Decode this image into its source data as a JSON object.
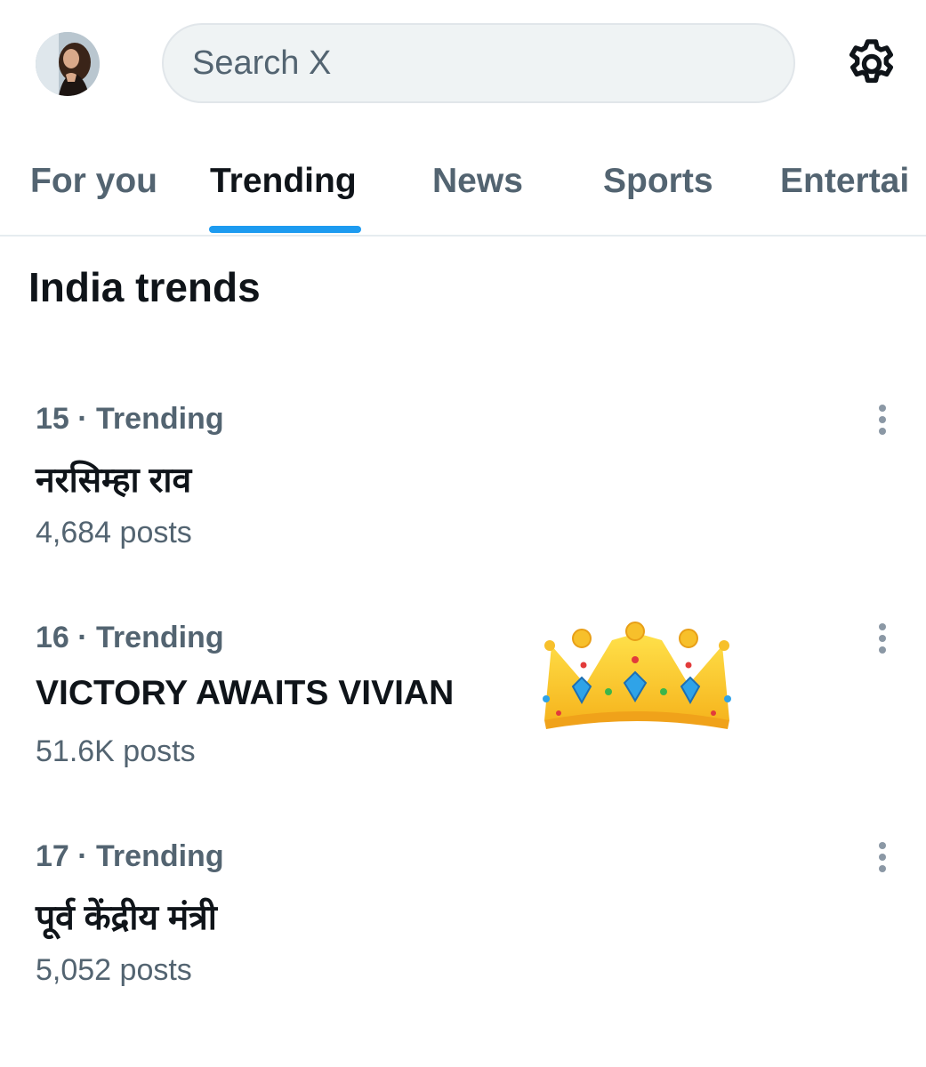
{
  "search": {
    "placeholder": "Search X"
  },
  "tabs": [
    {
      "label": "For you"
    },
    {
      "label": "Trending"
    },
    {
      "label": "News"
    },
    {
      "label": "Sports"
    },
    {
      "label": "Entertai"
    }
  ],
  "section_title": "India trends",
  "trends": [
    {
      "meta": "15 · Trending",
      "name": "नरसिम्हा राव",
      "posts": "4,684 posts"
    },
    {
      "meta": "16 · Trending",
      "name": "VICTORY AWAITS VIVIAN",
      "posts": "51.6K posts"
    },
    {
      "meta": "17 · Trending",
      "name": "पूर्व केंद्रीय मंत्री",
      "posts": "5,052 posts"
    }
  ],
  "icons": {
    "profile": "avatar",
    "settings": "gear-icon",
    "more": "more-vertical-icon",
    "crown": "crown-emoji"
  },
  "colors": {
    "accent": "#1d9bf0",
    "text_primary": "#0f1419",
    "text_secondary": "#536471",
    "search_bg": "#eff3f4"
  }
}
